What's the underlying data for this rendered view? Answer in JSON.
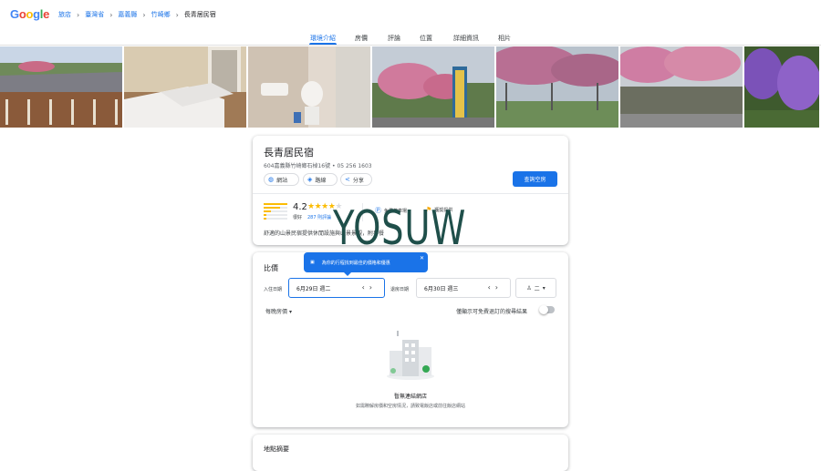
{
  "logo": {
    "letters": [
      "G",
      "o",
      "o",
      "g",
      "l",
      "e"
    ],
    "colors": [
      "#4285f4",
      "#ea4335",
      "#fbbc05",
      "#4285f4",
      "#34a853",
      "#ea4335"
    ]
  },
  "breadcrumb": {
    "items": [
      "旅店",
      "臺灣省",
      "嘉義縣",
      "竹崎鄉"
    ],
    "current": "長青居民宿"
  },
  "tabs": [
    "環境介紹",
    "房價",
    "評論",
    "位置",
    "詳細資訊",
    "相片"
  ],
  "active_tab": "環境介紹",
  "hotel": {
    "name": "長青居民宿",
    "address": "604嘉義縣竹崎鄉石棹16號 • 05 256 1603",
    "actions": [
      "網站",
      "路線",
      "分享"
    ],
    "check_availability": "查詢空房",
    "rating": "4.2",
    "stars_filled": 4,
    "rating_word": "很好",
    "review_count": "287 則評論",
    "amenities": [
      "免費停車場",
      "獲獎提供"
    ],
    "description": "舒適的山景民宿提供休閒設施與山景景觀，附早餐"
  },
  "watermark": "YOSUW",
  "prices": {
    "title": "比價",
    "tooltip": "為你的行程找到最佳的價格和優惠",
    "checkin_label": "入住日期",
    "checkin_value": "6月29日 週二",
    "checkout_label": "退房日期",
    "checkout_value": "6月30日 週三",
    "guests": "二",
    "per_night": "每晚房價",
    "free_cancel_label": "僅顯示可免費退訂的搜尋結果",
    "empty_title": "暫無連結網店",
    "empty_subtitle": "如需瞭解房價和空房情況，請致電飯店或前往飯店網站"
  },
  "location": {
    "title": "地點摘要"
  },
  "colors": {
    "accent": "#1a73e8",
    "star": "#fbbc04",
    "watermark": "#1f4f4a"
  },
  "icons": [
    "globe-icon",
    "directions-icon",
    "share-icon",
    "calendar-icon",
    "close-icon",
    "person-icon",
    "parking-icon",
    "flag-icon"
  ]
}
